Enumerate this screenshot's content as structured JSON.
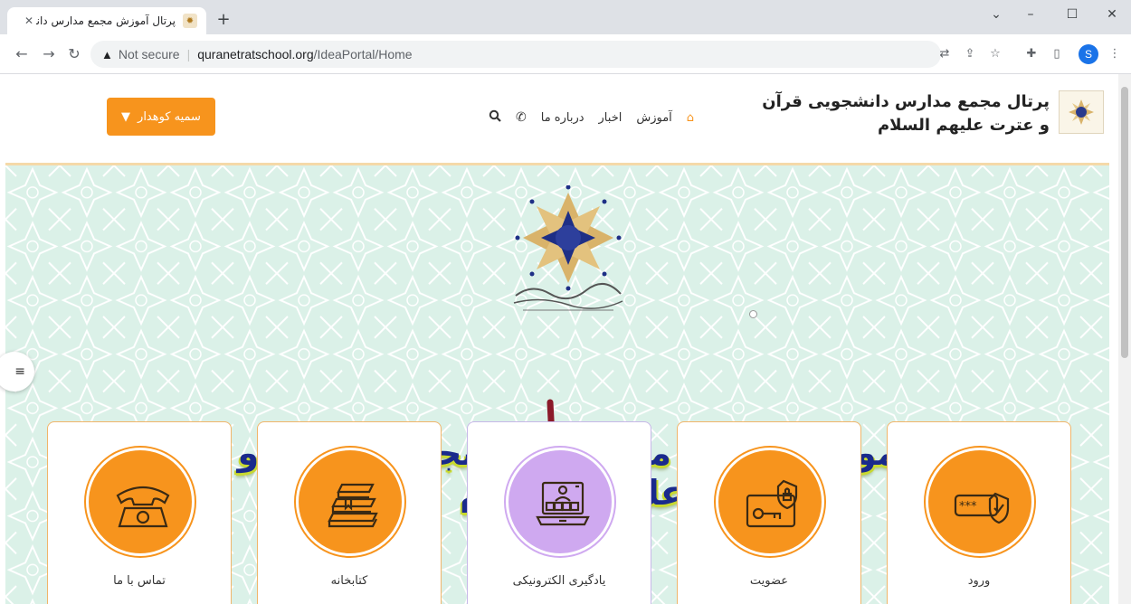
{
  "browser": {
    "tab_title": "پرتال آموزش مجمع مدارس دانشجو",
    "new_tab": "+",
    "minimize": "–",
    "restore": "☐",
    "close": "✕",
    "chevron": "⌄",
    "not_secure": "Not secure",
    "url_host": "quranetratschool.org",
    "url_path": "/IdeaPortal/Home",
    "profile_initial": "S"
  },
  "header": {
    "user_button_label": "سمیه کوهدار",
    "nav": {
      "home": "آموزش",
      "news": "اخبار",
      "about": "درباره ما"
    },
    "site_title_line1": "پرتال مجمع مدارس دانشجویی قرآن",
    "site_title_line2": "و عترت علیهم السلام"
  },
  "hero": {
    "heading": "پرتال آموزش مجمع مدارس دانشجویی قرآن و عترت علیهم السلام"
  },
  "cards": [
    {
      "label": "تماس با ما",
      "icon": "telephone-icon"
    },
    {
      "label": "کتابخانه",
      "icon": "books-icon"
    },
    {
      "label": "یادگیری الکترونیکی",
      "icon": "laptop-icon"
    },
    {
      "label": "عضویت",
      "icon": "key-card-icon"
    },
    {
      "label": "ورود",
      "icon": "password-shield-icon"
    }
  ],
  "colors": {
    "accent": "#f7941d",
    "active_card": "#cfa9f0",
    "heading": "#1a2a8c",
    "heading_shadow": "#c8d930"
  }
}
